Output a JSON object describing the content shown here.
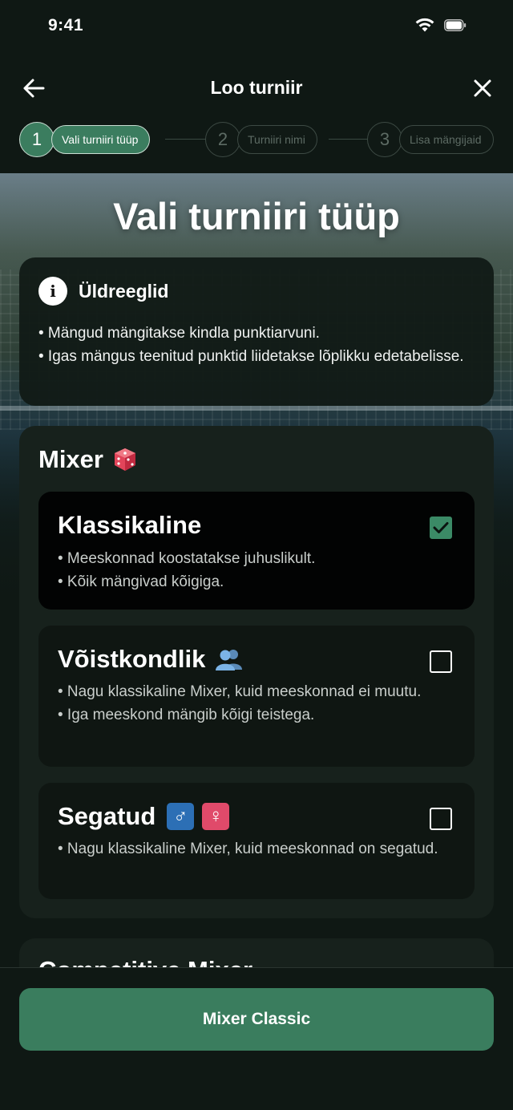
{
  "status_bar": {
    "time": "9:41"
  },
  "header": {
    "title": "Loo turniir"
  },
  "stepper": {
    "steps": [
      {
        "number": "1",
        "label": "Vali turniiri tüüp"
      },
      {
        "number": "2",
        "label": "Turniiri nimi"
      },
      {
        "number": "3",
        "label": "Lisa mängijaid"
      }
    ]
  },
  "page": {
    "title": "Vali turniiri tüüp"
  },
  "rules": {
    "title": "Üldreeglid",
    "items": [
      "• Mängud mängitakse kindla punktiarvuni.",
      "• Igas mängus teenitud punktid liidetakse lõplikku edetabelisse."
    ]
  },
  "mixer": {
    "title": "Mixer",
    "icon": "dice-icon",
    "options": [
      {
        "title": "Klassikaline",
        "selected": true,
        "desc": [
          "• Meeskonnad koostatakse juhuslikult.",
          "• Kõik mängivad kõigiga."
        ]
      },
      {
        "title": "Võistkondlik",
        "icon": "team-icon",
        "selected": false,
        "desc": [
          "• Nagu klassikaline Mixer, kuid meeskonnad ei muutu.",
          "• Iga meeskond mängib kõigi teistega."
        ]
      },
      {
        "title": "Segatud",
        "icons": [
          "♂",
          "♀"
        ],
        "selected": false,
        "desc": [
          "• Nagu klassikaline Mixer, kuid meeskonnad on segatud."
        ]
      }
    ]
  },
  "next_section": {
    "title": "Competitive Mixer"
  },
  "cta": {
    "label": "Mixer Classic"
  },
  "colors": {
    "accent": "#3a7d5e",
    "background": "#0f1814",
    "card": "#17211c"
  }
}
